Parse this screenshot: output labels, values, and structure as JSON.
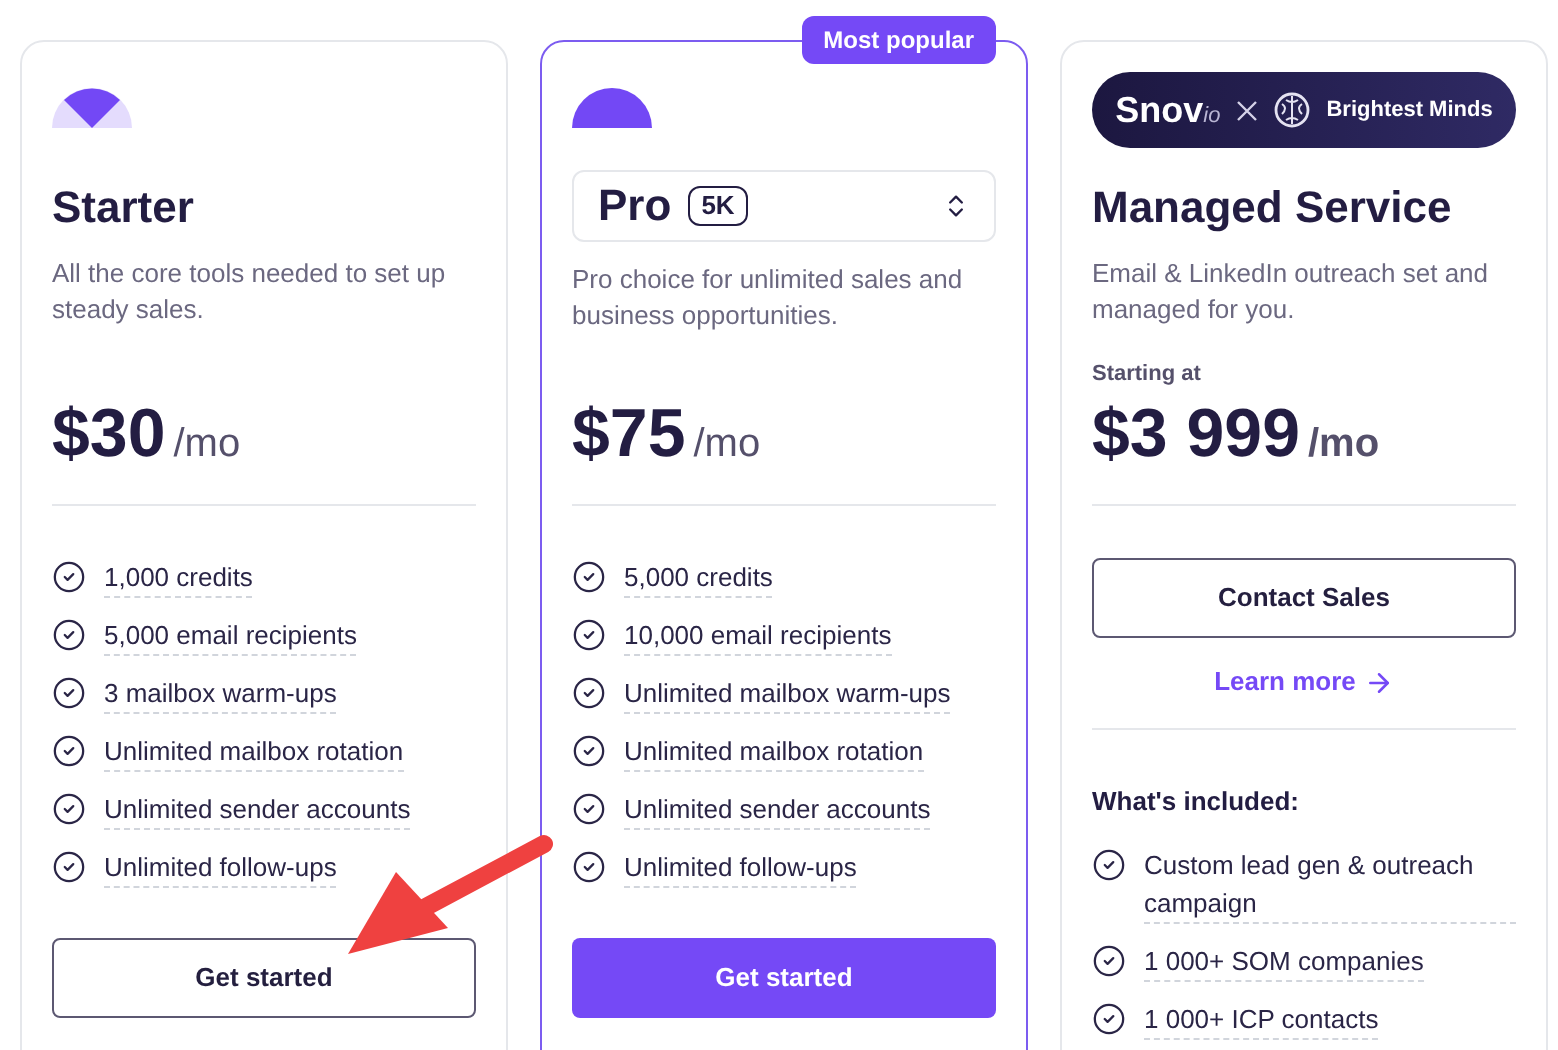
{
  "plans": [
    {
      "kind": "basic",
      "highlighted": false,
      "name": "Starter",
      "description": "All the core tools needed to set up steady sales.",
      "price": "$30",
      "period": "/mo",
      "features": [
        "1,000 credits",
        "5,000 email recipients",
        "3 mailbox warm-ups",
        "Unlimited mailbox rotation",
        "Unlimited sender accounts",
        "Unlimited follow-ups"
      ],
      "button": {
        "label": "Get started",
        "primary": false
      }
    },
    {
      "kind": "select",
      "highlighted": true,
      "badge": "Most popular",
      "name": "Pro",
      "tier": "5K",
      "description": "Pro choice for unlimited sales and business opportunities.",
      "price": "$75",
      "period": "/mo",
      "features": [
        "5,000 credits",
        "10,000 email recipients",
        "Unlimited mailbox warm-ups",
        "Unlimited mailbox rotation",
        "Unlimited sender accounts",
        "Unlimited follow-ups"
      ],
      "button": {
        "label": "Get started",
        "primary": true
      }
    },
    {
      "kind": "managed",
      "highlighted": false,
      "logo": {
        "brand": "Snov",
        "suffix": "io",
        "partner": "Brightest Minds"
      },
      "name": "Managed Service",
      "description": "Email & LinkedIn outreach set and managed for you.",
      "price_caption": "Starting at",
      "price": "$3 999",
      "period": "/mo",
      "button": {
        "label": "Contact Sales",
        "primary": false
      },
      "link": "Learn more",
      "features_title": "What's included:",
      "features": [
        "Custom lead gen & outreach campaign",
        "1 000+ SOM companies",
        "1 000+ ICP contacts"
      ]
    }
  ]
}
